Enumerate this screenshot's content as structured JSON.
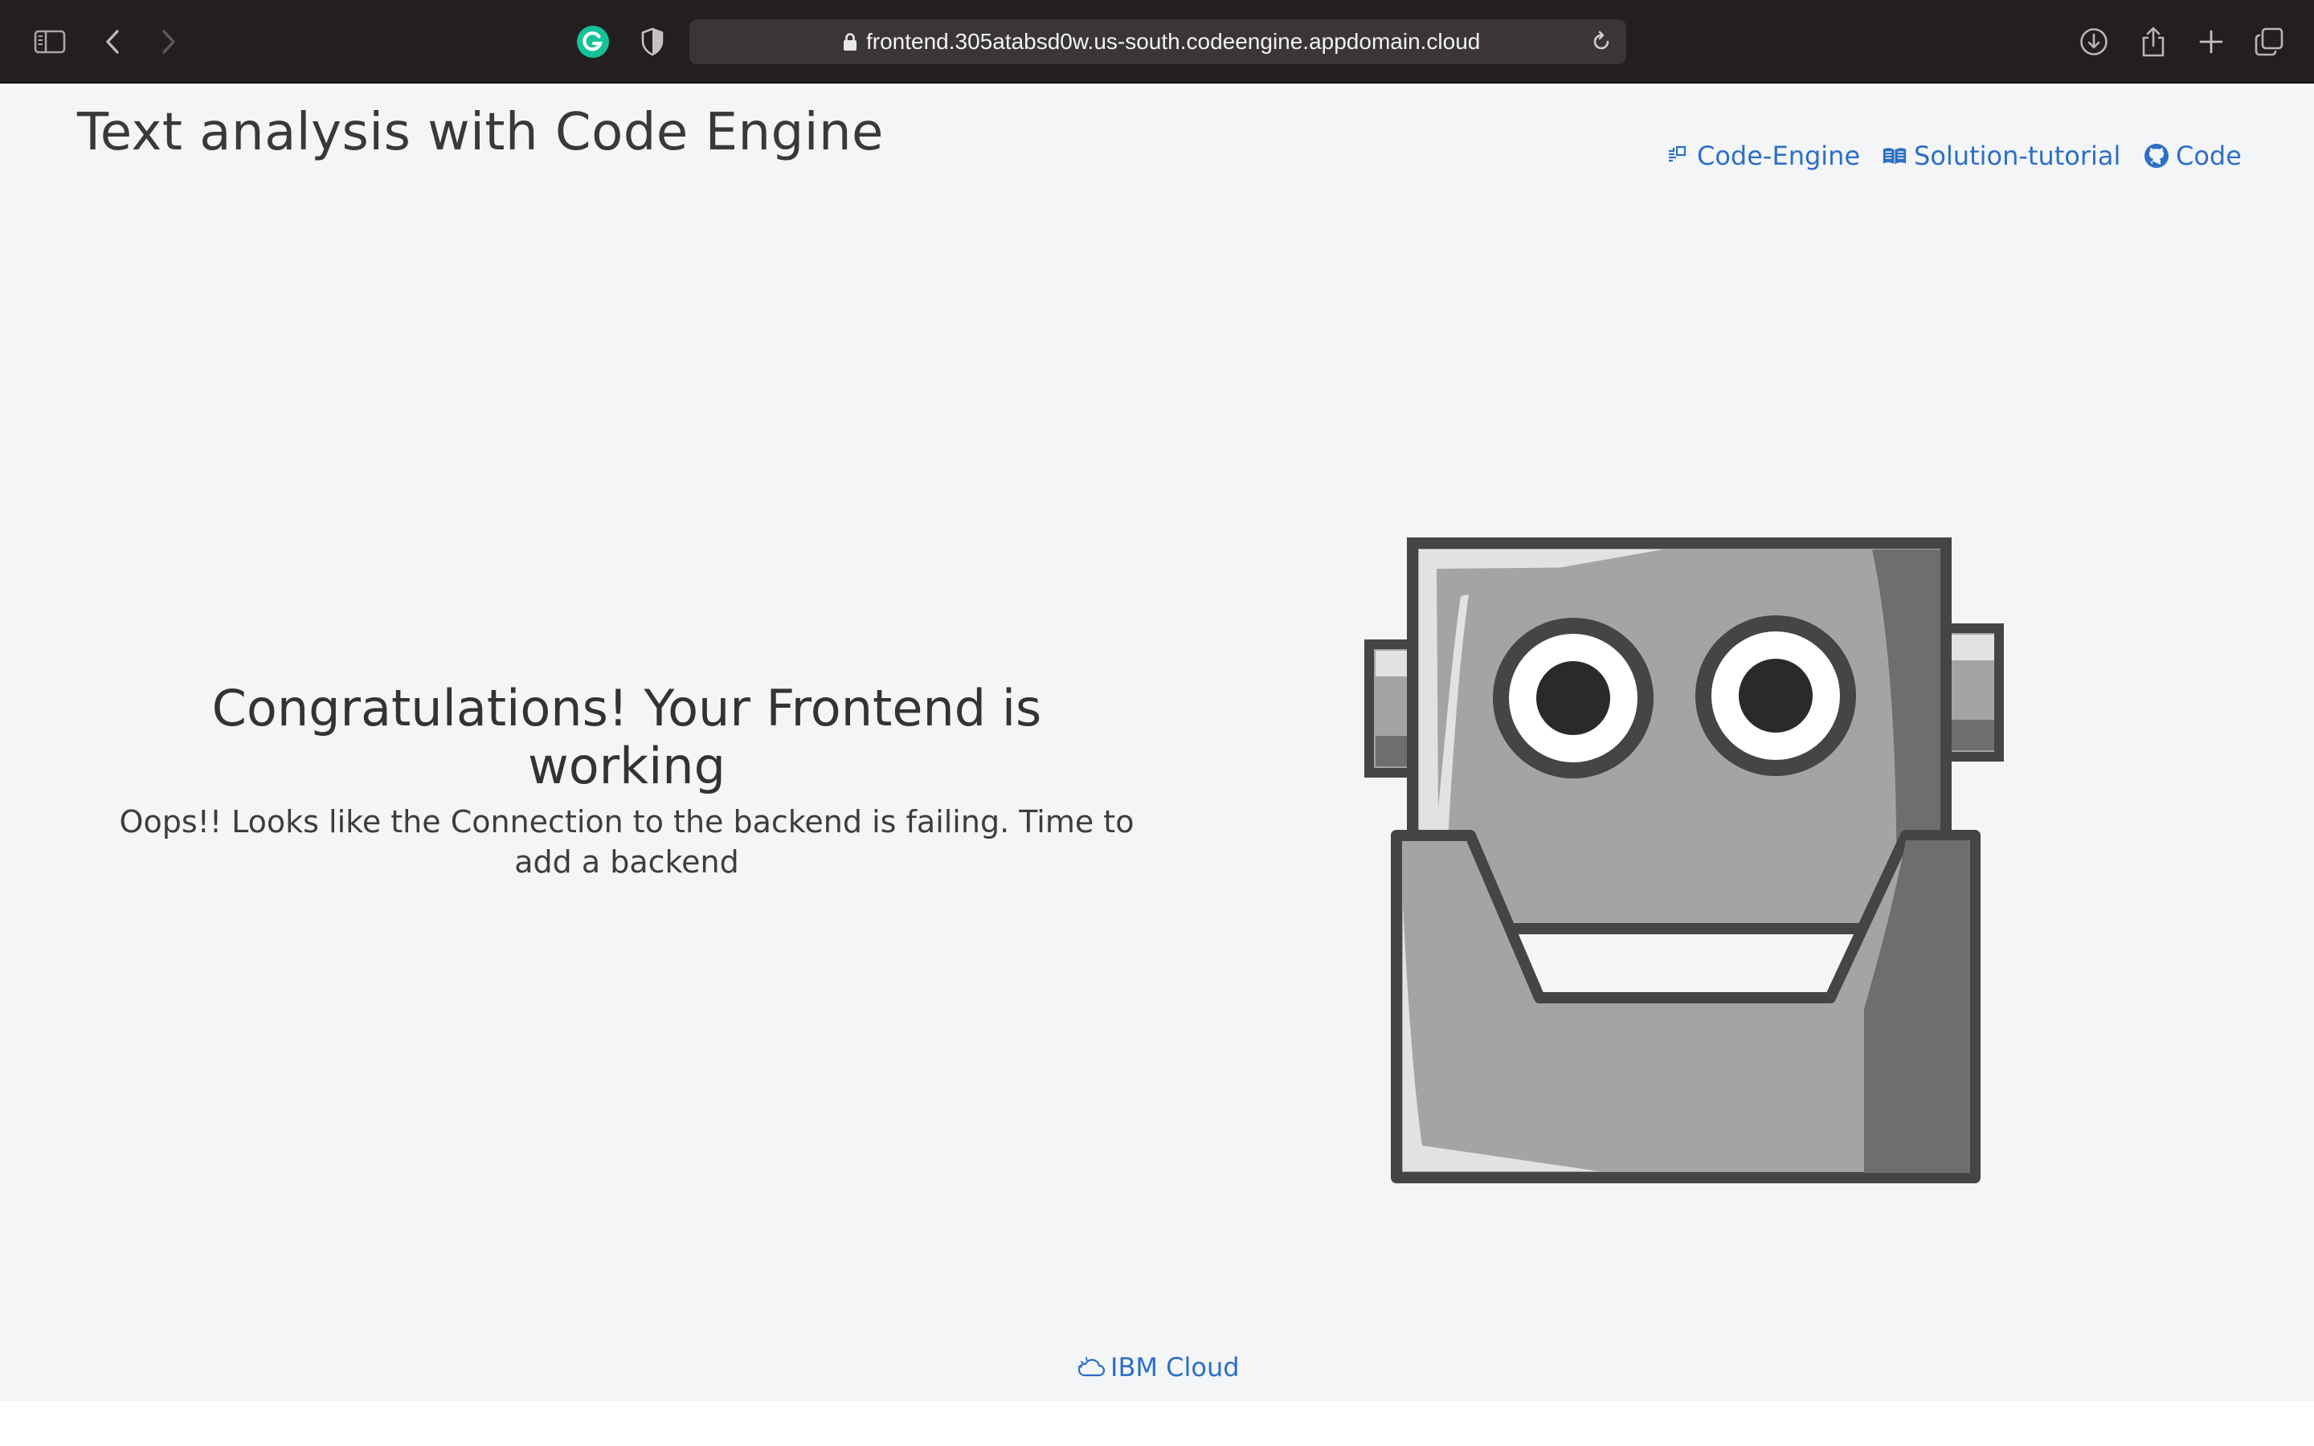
{
  "browser": {
    "url": "frontend.305atabsd0w.us-south.codeengine.appdomain.cloud",
    "icons": [
      "sidebar-icon",
      "back-icon",
      "forward-icon",
      "grammarly-icon",
      "shield-icon",
      "lock-icon",
      "reload-icon",
      "download-icon",
      "share-icon",
      "new-tab-icon",
      "tabs-overview-icon"
    ]
  },
  "header": {
    "title": "Text analysis with Code Engine"
  },
  "nav": {
    "code_engine": "Code-Engine",
    "solution_tutorial": "Solution-tutorial",
    "code": "Code"
  },
  "main": {
    "heading": "Congratulations! Your Frontend is working",
    "message": "Oops!! Looks like the Connection to the backend is failing. Time to add a backend"
  },
  "footer": {
    "ibm_cloud": "IBM Cloud"
  },
  "colors": {
    "link": "#2d6fc4",
    "toolbar": "#231f20",
    "grammarly": "#15c39a"
  }
}
